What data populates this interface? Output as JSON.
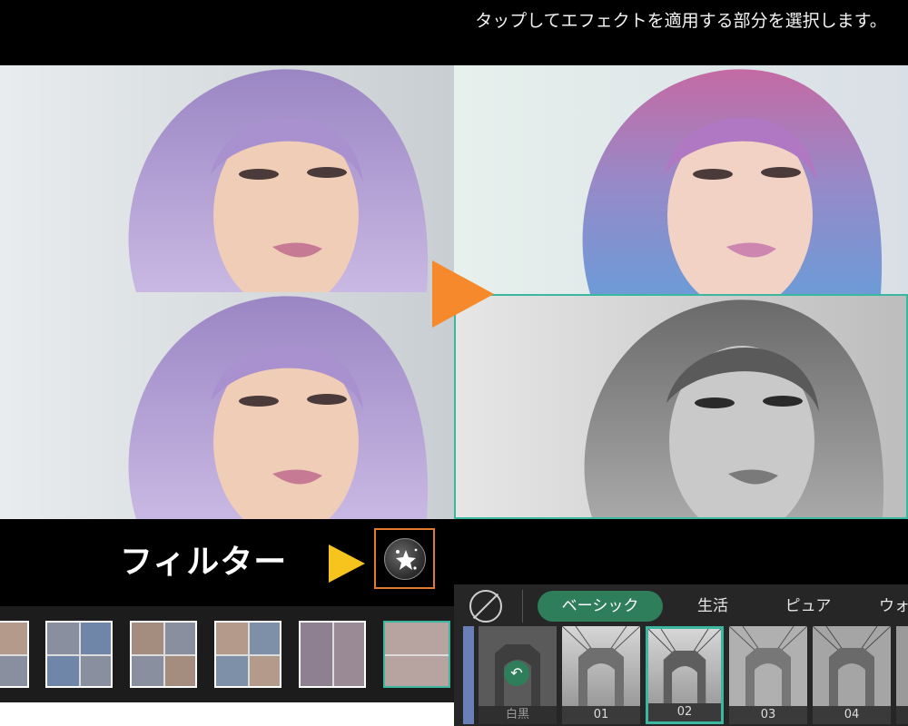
{
  "left_screen": {
    "filter_caption": "フィルター",
    "filter_button_icon": "sparkle-filter-icon",
    "layout_thumbnails": 6,
    "selected_layout_index": 5
  },
  "right_screen": {
    "instruction": "タップしてエフェクトを適用する部分を選択します。",
    "no_filter_icon": "no-filter-icon",
    "tabs": [
      {
        "label": "ベーシック",
        "active": true
      },
      {
        "label": "生活",
        "active": false
      },
      {
        "label": "ピュア",
        "active": false
      },
      {
        "label": "ウォ",
        "active": false
      }
    ],
    "presets": [
      {
        "label": "白黒",
        "selected": false
      },
      {
        "label": "01",
        "selected": false
      },
      {
        "label": "02",
        "selected": true
      },
      {
        "label": "03",
        "selected": false
      },
      {
        "label": "04",
        "selected": false
      }
    ]
  },
  "colors": {
    "accent_teal": "#3bb7a0",
    "active_tab_green": "#2e7d5b",
    "orange_arrow": "#f5892b",
    "yellow_arrow": "#f7c31d",
    "filter_button_border": "#e37a2f"
  }
}
